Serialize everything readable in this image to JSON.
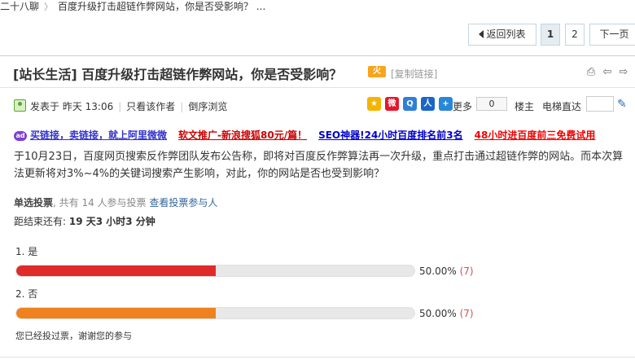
{
  "breadcrumb": {
    "item1": "二十八聊",
    "item2": "百度升级打击超链作弊网站，你是否受影响？ ..."
  },
  "pager": {
    "back_label": "返回列表",
    "page1": "1",
    "page2": "2",
    "next_label": "下一页"
  },
  "thread": {
    "title": "[站长生活] 百度升级打击超链作弊网站，你是否受影响？",
    "hot_badge": "火",
    "copy_link": "[复制链接]"
  },
  "author_bar": {
    "posted": "发表于 昨天 13:06",
    "only_author": "只看该作者",
    "reverse": "倒序浏览",
    "more": "更多",
    "share_count": "0",
    "louzhu": "楼主",
    "elevator": "电梯直达"
  },
  "ads": [
    {
      "text": "买链接，卖链接，就上阿里微微",
      "color": "#3333cc"
    },
    {
      "text": "软文推广-新浪搜狐80元/篇！",
      "color": "#cc0000"
    },
    {
      "text": "SEO神器!24小时百度排名前3名",
      "color": "#0000cc"
    },
    {
      "text": "48小时进百度前三免费试用",
      "color": "#ee0000"
    }
  ],
  "content": {
    "paragraph": "于10月23日，百度网页搜索反作弊团队发布公告称，即将对百度反作弊算法再一次升级，重点打击通过超链作弊的网站。而本次算法更新将对3%~4%的关键词搜索产生影响，对此，你的网站是否也受到影响？"
  },
  "poll": {
    "type_label": "单选投票",
    "total_text": ", 共有 14 人参与投票",
    "view_link": "查看投票参与人",
    "remaining_label": "距结束还有:",
    "remaining_value": "19 天3 小时3 分钟",
    "options": [
      {
        "label": "1.  是",
        "percent_text": "50.00%",
        "count_text": "(7)",
        "fraction": 0.5,
        "color": "#e02b2b"
      },
      {
        "label": "2.  否",
        "percent_text": "50.00%",
        "count_text": "(7)",
        "fraction": 0.5,
        "color": "#f0811f"
      }
    ],
    "voted_message": "您已经投过票，谢谢您的参与"
  }
}
